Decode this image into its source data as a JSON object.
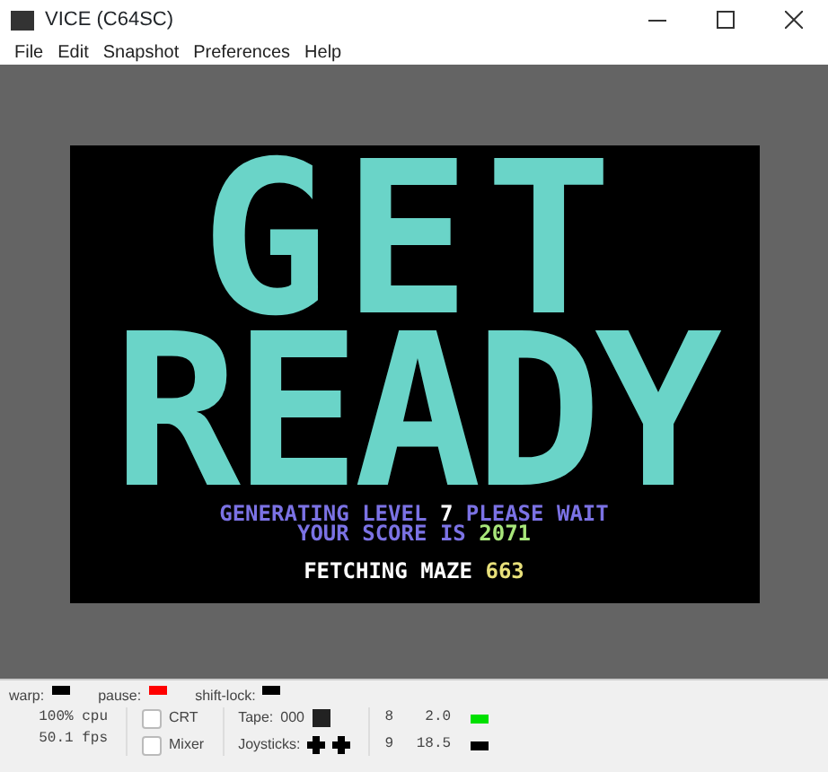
{
  "window": {
    "title": "VICE (C64SC)"
  },
  "menu": [
    "File",
    "Edit",
    "Snapshot",
    "Preferences",
    "Help"
  ],
  "screen": {
    "big_lines": [
      "GET",
      "READY"
    ],
    "lines": [
      [
        {
          "text": "GENERATING LEVEL ",
          "color": "#7b72e4"
        },
        {
          "text": "7",
          "color": "#ffffff"
        },
        {
          "text": " PLEASE WAIT",
          "color": "#7b72e4"
        }
      ],
      [
        {
          "text": "YOUR SCORE IS ",
          "color": "#7b72e4"
        },
        {
          "text": "2071",
          "color": "#a8e67a"
        }
      ],
      [
        {
          "text": "FETCHING MAZE ",
          "color": "#ffffff"
        },
        {
          "text": "663",
          "color": "#e8e07a"
        }
      ]
    ]
  },
  "status_bar": {
    "indicators": [
      {
        "label": "warp:",
        "color": "#000000"
      },
      {
        "label": "pause:",
        "color": "#ff0000"
      },
      {
        "label": "shift-lock:",
        "color": "#000000"
      }
    ],
    "cpu": "100% cpu",
    "fps": "50.1 fps",
    "checkboxes": [
      {
        "label": "CRT",
        "checked": false
      },
      {
        "label": "Mixer",
        "checked": false
      }
    ],
    "tape_label": "Tape:",
    "tape_counter": "000",
    "joysticks_label": "Joysticks:",
    "drives": [
      {
        "unit": "8",
        "track": "2.0",
        "color": "#00e000"
      },
      {
        "unit": "9",
        "track": "18.5",
        "color": "#000000"
      }
    ]
  }
}
